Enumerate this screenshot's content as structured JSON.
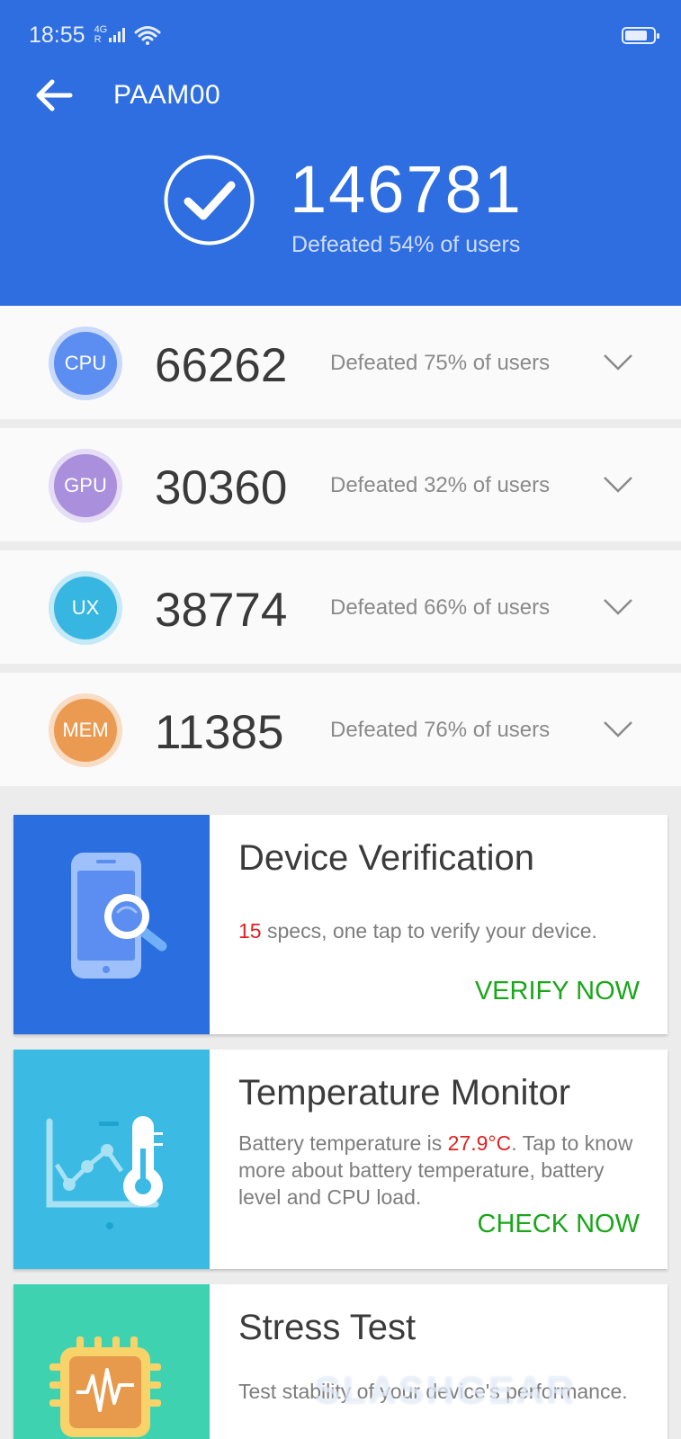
{
  "status": {
    "time": "18:55",
    "network": "4G",
    "signal_label": "R"
  },
  "header": {
    "title": "PAAM00",
    "total_score": "146781",
    "total_defeated": "Defeated 54% of users"
  },
  "scores": [
    {
      "label": "CPU",
      "score": "66262",
      "defeated": "Defeated 75% of users",
      "color": "#5b8ef0",
      "ring": "#c9d9fb"
    },
    {
      "label": "GPU",
      "score": "30360",
      "defeated": "Defeated 32% of users",
      "color": "#a98fdc",
      "ring": "#e5dcf5"
    },
    {
      "label": "UX",
      "score": "38774",
      "defeated": "Defeated 66% of users",
      "color": "#37b6e2",
      "ring": "#c5e9f6"
    },
    {
      "label": "MEM",
      "score": "11385",
      "defeated": "Defeated 76% of users",
      "color": "#eb9a52",
      "ring": "#f8dcc3"
    }
  ],
  "cards": {
    "verify": {
      "title": "Device Verification",
      "count": "15",
      "desc": " specs, one tap to verify your device.",
      "action": "VERIFY NOW",
      "color": "#2a6ee0"
    },
    "temp": {
      "title": "Temperature Monitor",
      "desc_pre": "Battery temperature is ",
      "temp": "27.9°C",
      "desc_post": ". Tap to know more about battery temperature, battery level and CPU load.",
      "action": "CHECK NOW",
      "color": "#3bbbe4"
    },
    "stress": {
      "title": "Stress Test",
      "desc": "Test stability of your device's performance.",
      "color": "#3fd2b1"
    }
  },
  "watermark": "SLASHGEAR"
}
